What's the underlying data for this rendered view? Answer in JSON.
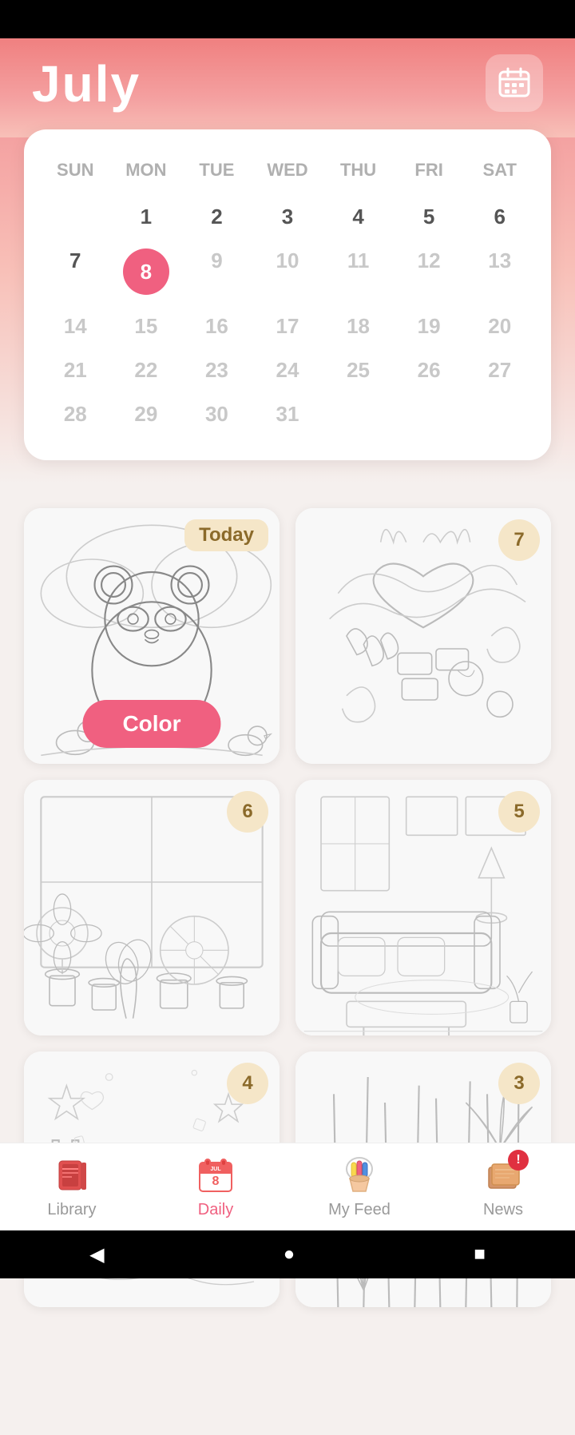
{
  "status_bar": {},
  "header": {
    "title": "July",
    "calendar_icon": "calendar-icon"
  },
  "calendar": {
    "day_headers": [
      "SUN",
      "MON",
      "TUE",
      "WED",
      "THU",
      "FRI",
      "SAT"
    ],
    "weeks": [
      [
        null,
        "1",
        "2",
        "3",
        "4",
        "5",
        "6"
      ],
      [
        "7",
        "8",
        "9",
        "10",
        "11",
        "12",
        "13"
      ],
      [
        "14",
        "15",
        "16",
        "17",
        "18",
        "19",
        "20"
      ],
      [
        "21",
        "22",
        "23",
        "24",
        "25",
        "26",
        "27"
      ],
      [
        "28",
        "29",
        "30",
        "31",
        null,
        null,
        null
      ]
    ],
    "today_day": "8",
    "today_col": 1
  },
  "image_cards": [
    {
      "id": "card-today",
      "badge": "Today",
      "badge_type": "today",
      "color_btn": "Color",
      "description": "Panda coloring page"
    },
    {
      "id": "card-7",
      "badge": "7",
      "badge_type": "number",
      "description": "Food collage coloring page"
    },
    {
      "id": "card-6",
      "badge": "6",
      "badge_type": "number",
      "description": "Garden flowers coloring page"
    },
    {
      "id": "card-5",
      "badge": "5",
      "badge_type": "number",
      "description": "Living room coloring page"
    },
    {
      "id": "card-4",
      "badge": "4",
      "badge_type": "number",
      "description": "Happy text coloring page"
    },
    {
      "id": "card-3",
      "badge": "3",
      "badge_type": "number",
      "description": "Plants coloring page"
    }
  ],
  "bottom_nav": {
    "items": [
      {
        "id": "library",
        "label": "Library",
        "icon": "book-icon",
        "active": false
      },
      {
        "id": "daily",
        "label": "Daily",
        "icon": "daily-icon",
        "active": true
      },
      {
        "id": "myfeed",
        "label": "My Feed",
        "icon": "palette-icon",
        "active": false
      },
      {
        "id": "news",
        "label": "News",
        "icon": "news-icon",
        "active": false,
        "badge": "!"
      }
    ]
  },
  "system_nav": {
    "back": "◀",
    "home": "●",
    "recent": "■"
  }
}
